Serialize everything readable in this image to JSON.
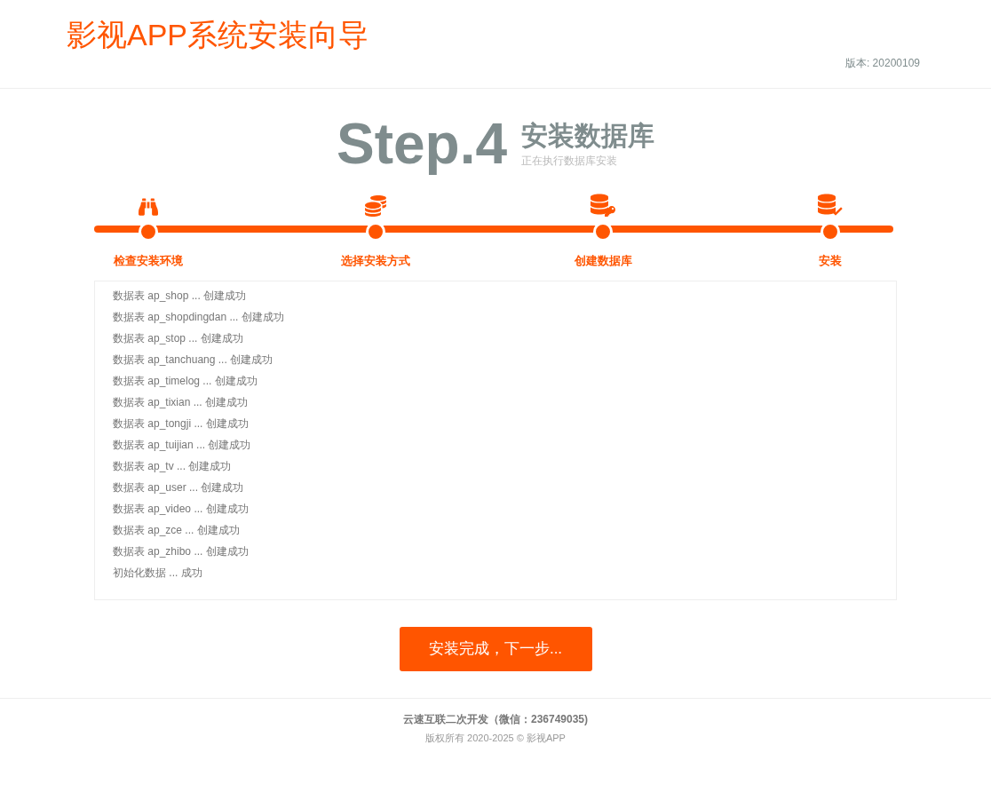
{
  "header": {
    "title": "影视APP系统安装向导",
    "version": "版本: 20200109"
  },
  "step": {
    "number": "Step.4",
    "title": "安装数据库",
    "subtitle": "正在执行数据库安装"
  },
  "steps": [
    {
      "label": "检查安装环境",
      "kind": "binoculars"
    },
    {
      "label": "选择安装方式",
      "kind": "coins"
    },
    {
      "label": "创建数据库",
      "kind": "database-key"
    },
    {
      "label": "安装",
      "kind": "database-check"
    }
  ],
  "log": [
    "数据表 ap_shop ... 创建成功",
    "数据表 ap_shopdingdan ... 创建成功",
    "数据表 ap_stop ... 创建成功",
    "数据表 ap_tanchuang ... 创建成功",
    "数据表 ap_timelog ... 创建成功",
    "数据表 ap_tixian ... 创建成功",
    "数据表 ap_tongji ... 创建成功",
    "数据表 ap_tuijian ... 创建成功",
    "数据表 ap_tv ... 创建成功",
    "数据表 ap_user ... 创建成功",
    "数据表 ap_video ... 创建成功",
    "数据表 ap_zce ... 创建成功",
    "数据表 ap_zhibo ... 创建成功",
    "初始化数据 ... 成功"
  ],
  "button": "安装完成，下一步...",
  "footer": {
    "credit": "云速互联二次开发（微信：236749035)",
    "copyright": "版权所有 2020-2025 © 影视APP"
  }
}
